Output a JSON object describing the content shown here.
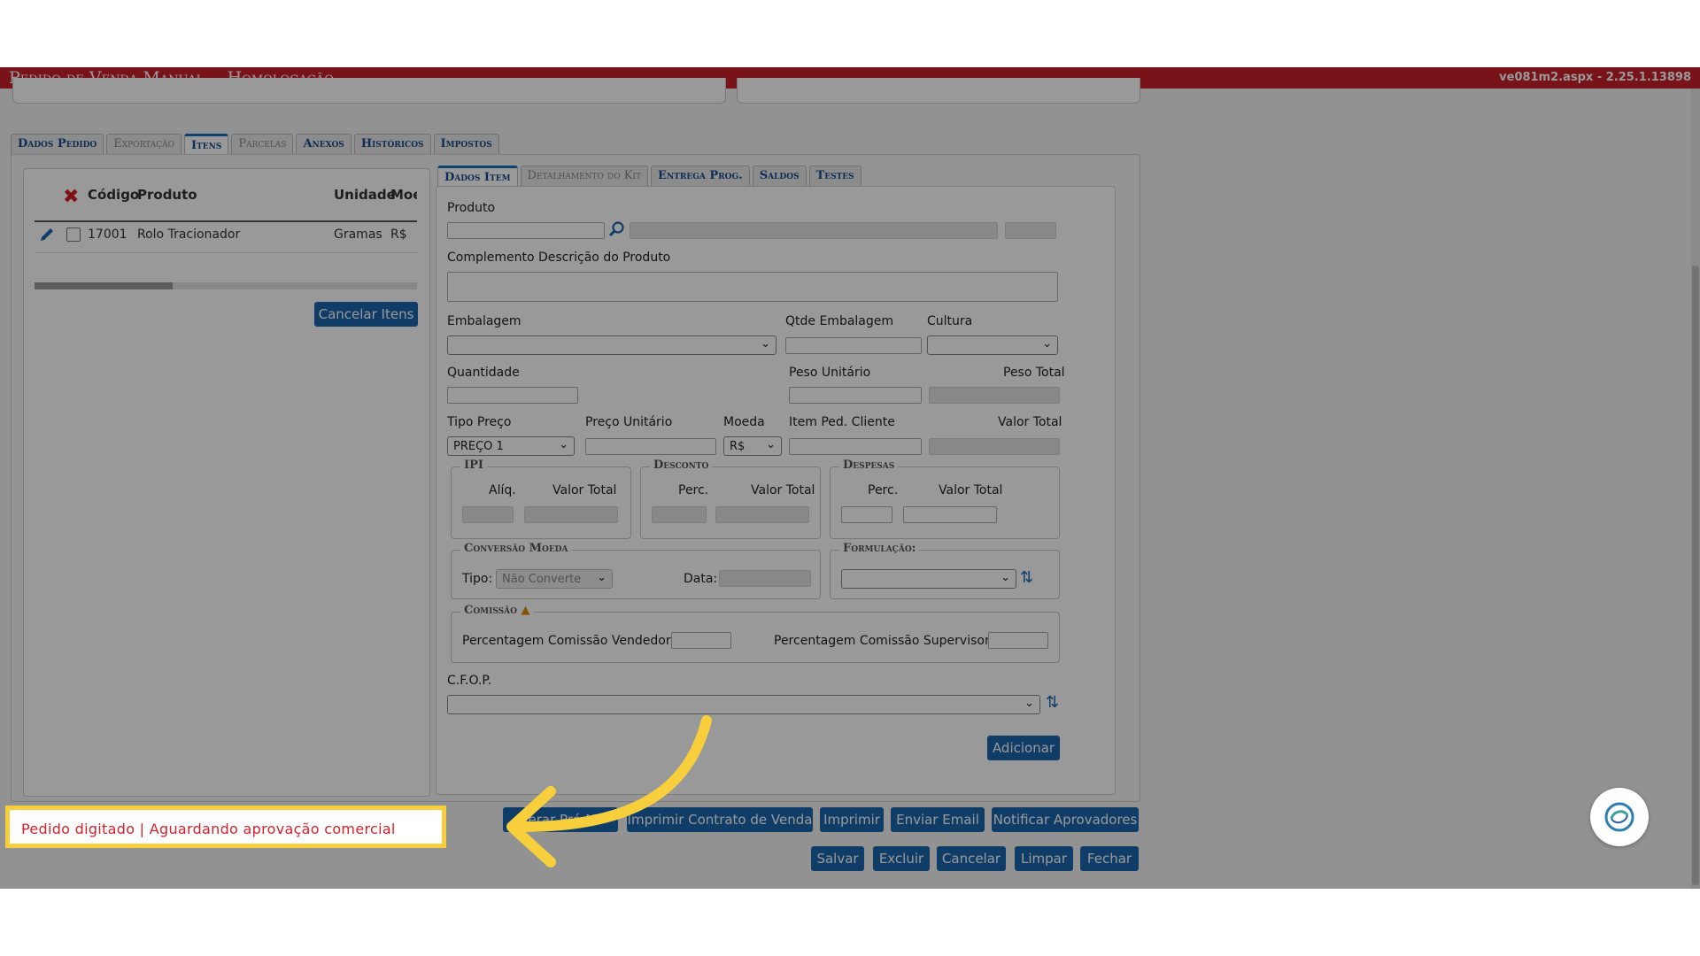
{
  "app": {
    "title": "Pedido de Venda Manual",
    "environment": "- Homologação",
    "version": "ve081m2.aspx - 2.25.1.13898"
  },
  "main_tabs": [
    {
      "label": "Dados Pedido",
      "state": "enabled"
    },
    {
      "label": "Exportação",
      "state": "disabled"
    },
    {
      "label": "Itens",
      "state": "active"
    },
    {
      "label": "Parcelas",
      "state": "disabled"
    },
    {
      "label": "Anexos",
      "state": "enabled"
    },
    {
      "label": "Históricos",
      "state": "enabled"
    },
    {
      "label": "Impostos",
      "state": "enabled"
    }
  ],
  "items_table": {
    "headers": {
      "codigo": "Código",
      "produto": "Produto",
      "unidade": "Unidade",
      "moeda": "Moe"
    },
    "rows": [
      {
        "codigo": "17001",
        "produto": "Rolo Tracionador",
        "unidade": "Gramas",
        "moeda": "R$"
      }
    ],
    "cancel_button": "Cancelar Itens"
  },
  "item_tabs": [
    {
      "label": "Dados Item",
      "state": "active"
    },
    {
      "label": "Detalhamento do Kit",
      "state": "disabled"
    },
    {
      "label": "Entrega Prog.",
      "state": "enabled"
    },
    {
      "label": "Saldos",
      "state": "enabled"
    },
    {
      "label": "Testes",
      "state": "enabled"
    }
  ],
  "form": {
    "produto_label": "Produto",
    "complemento_label": "Complemento Descrição do Produto",
    "embalagem_label": "Embalagem",
    "qtde_embalagem_label": "Qtde Embalagem",
    "cultura_label": "Cultura",
    "quantidade_label": "Quantidade",
    "peso_unitario_label": "Peso Unitário",
    "peso_total_label": "Peso Total",
    "tipo_preco_label": "Tipo Preço",
    "tipo_preco_value": "PREÇO 1",
    "preco_unitario_label": "Preço Unitário",
    "moeda_label": "Moeda",
    "moeda_value": "R$",
    "item_ped_cliente_label": "Item Ped. Cliente",
    "valor_total_label": "Valor Total",
    "ipi": {
      "legend": "IPI",
      "aliq_label": "Alíq.",
      "valor_label": "Valor Total"
    },
    "desconto": {
      "legend": "Desconto",
      "perc_label": "Perc.",
      "valor_label": "Valor Total"
    },
    "despesas": {
      "legend": "Despesas",
      "perc_label": "Perc.",
      "valor_label": "Valor Total"
    },
    "conversao": {
      "legend": "Conversão Moeda",
      "tipo_label": "Tipo:",
      "tipo_value": "Não Converte",
      "data_label": "Data:"
    },
    "formulacao": {
      "legend": "Formulação:"
    },
    "comissao": {
      "legend": "Comissão",
      "vendedor_label": "Percentagem Comissão Vendedor:",
      "supervisor_label": "Percentagem Comissão Supervisor:"
    },
    "cfop_label": "C.F.O.P.",
    "adicionar_button": "Adicionar"
  },
  "bottom_buttons": {
    "row1": [
      "Gerar Pré-NF",
      "Imprimir Contrato de Venda",
      "Imprimir",
      "Enviar Email",
      "Notificar Aprovadores"
    ],
    "row2": [
      "Salvar",
      "Excluir",
      "Cancelar",
      "Limpar",
      "Fechar"
    ]
  },
  "status_callout": "Pedido digitado | Aguardando aprovação comercial",
  "colors": {
    "titlebar": "#c8202a",
    "button": "#1a66ad",
    "callout_border": "#f7cf3d",
    "arrow": "#f7cf3d",
    "status_text": "#d8202a"
  }
}
